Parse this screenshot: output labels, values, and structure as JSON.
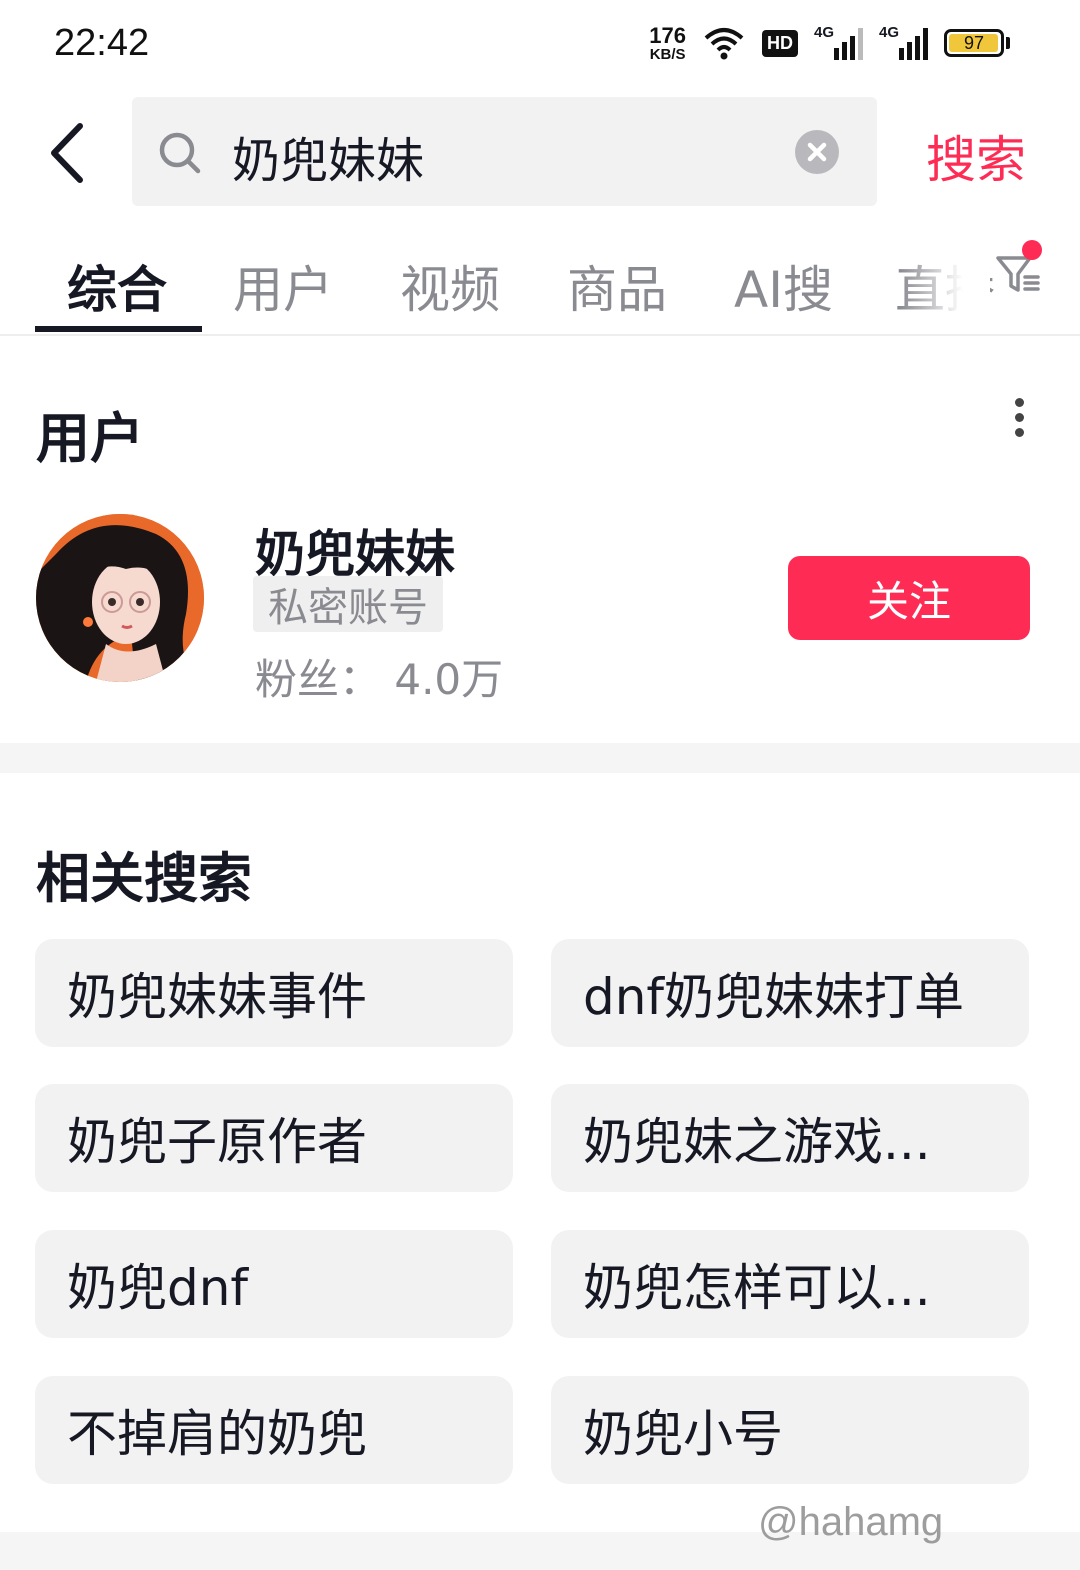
{
  "status_bar": {
    "time": "22:42",
    "net_speed_value": "176",
    "net_speed_unit": "KB/S",
    "hd_label": "HD",
    "signal_1_label": "4G",
    "signal_2_label": "4G",
    "battery_level": "97"
  },
  "search": {
    "query": "奶兜妹妹",
    "submit_label": "搜索"
  },
  "tabs": [
    {
      "label": "综合",
      "active": true
    },
    {
      "label": "用户",
      "active": false
    },
    {
      "label": "视频",
      "active": false
    },
    {
      "label": "商品",
      "active": false
    },
    {
      "label": "AI搜",
      "active": false
    },
    {
      "label": "直播",
      "active": false
    }
  ],
  "user_section": {
    "title": "用户",
    "user": {
      "name": "奶兜妹妹",
      "badge": "私密账号",
      "fans": "粉丝： 4.0万"
    },
    "follow_label": "关注"
  },
  "related": {
    "title": "相关搜索",
    "items": [
      "奶兜妹妹事件",
      "dnf奶兜妹妹打单",
      "奶兜子原作者",
      "奶兜妹之游戏...",
      "奶兜dnf",
      "奶兜怎样可以...",
      "不掉肩的奶兜",
      "奶兜小号"
    ]
  },
  "watermark": "@hahamg",
  "colors": {
    "accent": "#fe2c55",
    "text_primary": "#161823",
    "text_secondary": "#8a8b91",
    "chip_bg": "#f2f2f3"
  }
}
